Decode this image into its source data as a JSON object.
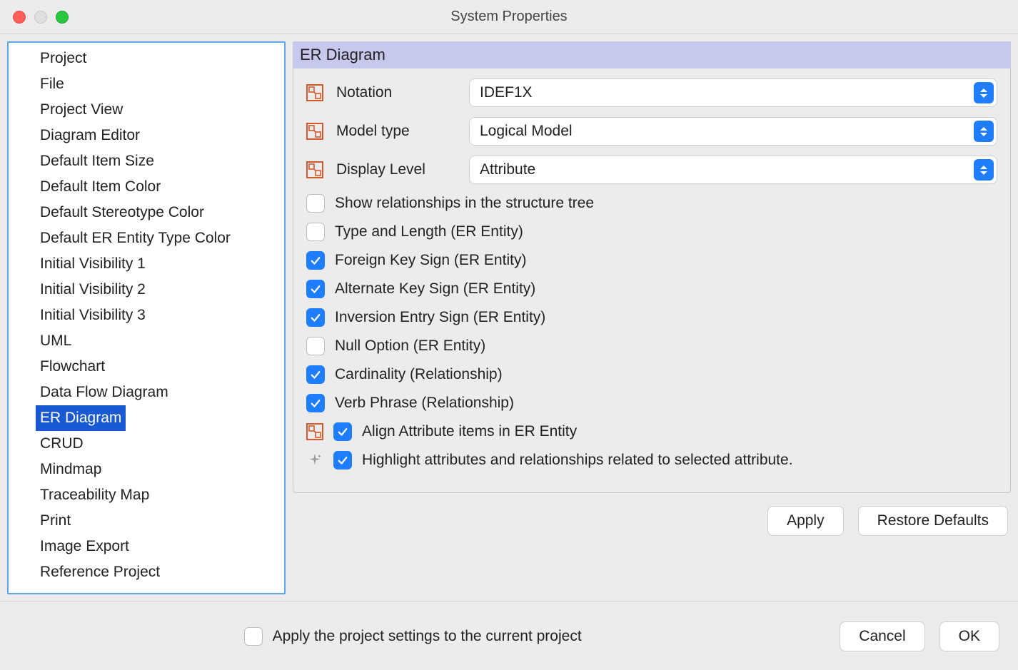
{
  "window": {
    "title": "System Properties"
  },
  "sidebar": {
    "items": [
      "Project",
      "File",
      "Project View",
      "Diagram Editor",
      "Default Item Size",
      "Default Item Color",
      "Default Stereotype Color",
      "Default ER Entity Type Color",
      "Initial Visibility 1",
      "Initial Visibility 2",
      "Initial Visibility 3",
      "UML",
      "Flowchart",
      "Data Flow Diagram",
      "ER Diagram",
      "CRUD",
      "Mindmap",
      "Traceability Map",
      "Print",
      "Image Export",
      "Reference Project"
    ],
    "selected_index": 14
  },
  "panel": {
    "header": "ER Diagram",
    "fields": {
      "notation": {
        "label": "Notation",
        "value": "IDEF1X"
      },
      "model_type": {
        "label": "Model type",
        "value": "Logical Model"
      },
      "display_level": {
        "label": "Display Level",
        "value": "Attribute"
      }
    },
    "checks": {
      "show_rel_tree": {
        "label": "Show relationships in the structure tree",
        "checked": false
      },
      "type_length": {
        "label": "Type and Length (ER Entity)",
        "checked": false
      },
      "fk_sign": {
        "label": "Foreign Key Sign (ER Entity)",
        "checked": true
      },
      "ak_sign": {
        "label": "Alternate Key Sign (ER Entity)",
        "checked": true
      },
      "ie_sign": {
        "label": "Inversion Entry Sign (ER Entity)",
        "checked": true
      },
      "null_option": {
        "label": "Null Option (ER Entity)",
        "checked": false
      },
      "cardinality": {
        "label": "Cardinality (Relationship)",
        "checked": true
      },
      "verb_phrase": {
        "label": "Verb Phrase (Relationship)",
        "checked": true
      },
      "align_attr": {
        "label": "Align Attribute items in ER Entity",
        "checked": true
      },
      "highlight": {
        "label": "Highlight attributes and relationships related to selected attribute.",
        "checked": true
      }
    },
    "buttons": {
      "apply": "Apply",
      "restore": "Restore Defaults"
    }
  },
  "footer": {
    "apply_settings_label": "Apply the project settings to the current project",
    "apply_settings_checked": false,
    "cancel": "Cancel",
    "ok": "OK"
  }
}
